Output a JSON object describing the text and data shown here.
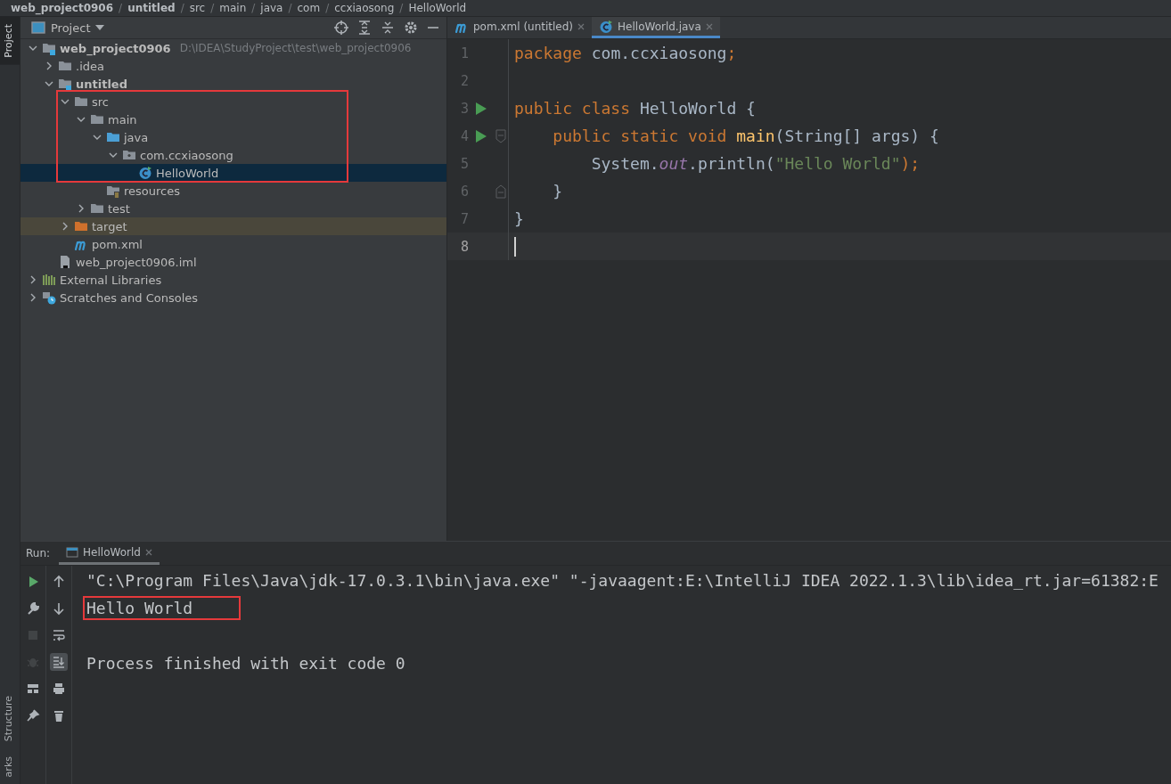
{
  "breadcrumbs": {
    "separator": "/",
    "items": [
      "web_project0906",
      "untitled",
      "src",
      "main",
      "java",
      "com",
      "ccxiaosong",
      "HelloWorld"
    ]
  },
  "side_stripe": {
    "top": [
      {
        "label": "Project",
        "selected": true
      }
    ],
    "bottom": [
      {
        "label": "Structure",
        "selected": false
      },
      {
        "label": "arks",
        "selected": false
      }
    ]
  },
  "project": {
    "title": "Project",
    "tree": [
      {
        "label": "web_project0906",
        "kind": "module",
        "hint": "D:\\IDEA\\StudyProject\\test\\web_project0906",
        "expanded": true,
        "selected": false,
        "boxed": false,
        "children": [
          {
            "label": ".idea",
            "kind": "folder",
            "expanded": false,
            "selected": false,
            "boxed": false
          },
          {
            "label": "untitled",
            "kind": "module",
            "expanded": true,
            "selected": false,
            "boxed": false,
            "children": [
              {
                "label": "src",
                "kind": "folder",
                "expanded": true,
                "selected": false,
                "boxed": true,
                "children": [
                  {
                    "label": "main",
                    "kind": "folder",
                    "expanded": true,
                    "selected": false,
                    "boxed": true,
                    "children": [
                      {
                        "label": "java",
                        "kind": "source-folder",
                        "expanded": true,
                        "selected": false,
                        "boxed": true,
                        "children": [
                          {
                            "label": "com.ccxiaosong",
                            "kind": "package",
                            "expanded": true,
                            "selected": false,
                            "boxed": true,
                            "children": [
                              {
                                "label": "HelloWorld",
                                "kind": "class",
                                "selected": true,
                                "boxed": true
                              }
                            ]
                          }
                        ]
                      },
                      {
                        "label": "resources",
                        "kind": "resources-folder",
                        "selected": false,
                        "boxed": false
                      }
                    ]
                  },
                  {
                    "label": "test",
                    "kind": "folder",
                    "expanded": false,
                    "selected": false,
                    "boxed": false
                  }
                ]
              },
              {
                "label": "target",
                "kind": "excluded-folder",
                "expanded": false,
                "selected": false,
                "boxed": false
              },
              {
                "label": "pom.xml",
                "kind": "maven",
                "selected": false,
                "boxed": false
              }
            ]
          },
          {
            "label": "web_project0906.iml",
            "kind": "iml",
            "selected": false,
            "boxed": false
          }
        ]
      },
      {
        "label": "External Libraries",
        "kind": "libraries",
        "expanded": false,
        "selected": false,
        "boxed": false
      },
      {
        "label": "Scratches and Consoles",
        "kind": "scratches",
        "expanded": false,
        "selected": false,
        "boxed": false
      }
    ]
  },
  "editor": {
    "tabs": [
      {
        "label": "pom.xml (untitled)",
        "kind": "maven",
        "selected": false
      },
      {
        "label": "HelloWorld.java",
        "kind": "class",
        "selected": true
      }
    ],
    "lines": [
      {
        "number": "1",
        "run": false,
        "fold_start": false,
        "fold_end": false,
        "current": false,
        "tokens": [
          {
            "t": "package ",
            "kind": "keyword"
          },
          {
            "t": "com.ccxiaosong",
            "kind": "plain"
          },
          {
            "t": ";",
            "kind": "keyword"
          }
        ]
      },
      {
        "number": "2",
        "run": false,
        "fold_start": false,
        "fold_end": false,
        "current": false
      },
      {
        "number": "3",
        "run": true,
        "fold_start": false,
        "fold_end": false,
        "current": false,
        "tokens": [
          {
            "t": "public class ",
            "kind": "keyword"
          },
          {
            "t": "HelloWorld {",
            "kind": "plain"
          }
        ]
      },
      {
        "number": "4",
        "run": true,
        "fold_start": true,
        "fold_end": false,
        "current": false,
        "tokens": [
          {
            "t": "    public static void ",
            "kind": "keyword"
          },
          {
            "t": "main",
            "kind": "method"
          },
          {
            "t": "(String[] args) {",
            "kind": "plain"
          }
        ]
      },
      {
        "number": "5",
        "run": false,
        "fold_start": false,
        "fold_end": false,
        "current": false,
        "tokens": [
          {
            "t": "        System.",
            "kind": "plain"
          },
          {
            "t": "out",
            "kind": "field"
          },
          {
            "t": ".println(",
            "kind": "plain"
          },
          {
            "t": "\"Hello World\"",
            "kind": "string"
          },
          {
            "t": ");",
            "kind": "keyword"
          }
        ]
      },
      {
        "number": "6",
        "run": false,
        "fold_start": false,
        "fold_end": true,
        "current": false,
        "tokens": [
          {
            "t": "    }",
            "kind": "plain"
          }
        ]
      },
      {
        "number": "7",
        "run": false,
        "fold_start": false,
        "fold_end": false,
        "current": false,
        "tokens": [
          {
            "t": "}",
            "kind": "plain"
          }
        ]
      },
      {
        "number": "8",
        "run": false,
        "fold_start": false,
        "fold_end": false,
        "current": true
      }
    ]
  },
  "run": {
    "label": "Run:",
    "tabs": [
      {
        "label": "HelloWorld",
        "selected": true
      }
    ],
    "left_tools": [
      {
        "kind": "rerun",
        "disabled": false
      },
      {
        "kind": "wrench",
        "disabled": false
      },
      {
        "kind": "stop",
        "disabled": true
      },
      {
        "kind": "bug",
        "disabled": true
      },
      {
        "kind": "layout",
        "disabled": false
      },
      {
        "kind": "pin",
        "disabled": false
      }
    ],
    "console_tools": [
      {
        "kind": "up",
        "on": false
      },
      {
        "kind": "down",
        "on": false
      },
      {
        "kind": "wrap",
        "on": false
      },
      {
        "kind": "scroll-end",
        "on": true
      },
      {
        "kind": "print",
        "on": false
      },
      {
        "kind": "trash",
        "on": false
      }
    ],
    "console": [
      {
        "kind": "text",
        "text": "\"C:\\Program Files\\Java\\jdk-17.0.3.1\\bin\\java.exe\" \"-javaagent:E:\\IntelliJ IDEA 2022.1.3\\lib\\idea_rt.jar=61382:E",
        "boxed": false
      },
      {
        "kind": "text",
        "text": "Hello World",
        "boxed": true
      },
      {
        "kind": "blank"
      },
      {
        "kind": "text",
        "text": "Process finished with exit code 0",
        "boxed": false
      }
    ]
  }
}
